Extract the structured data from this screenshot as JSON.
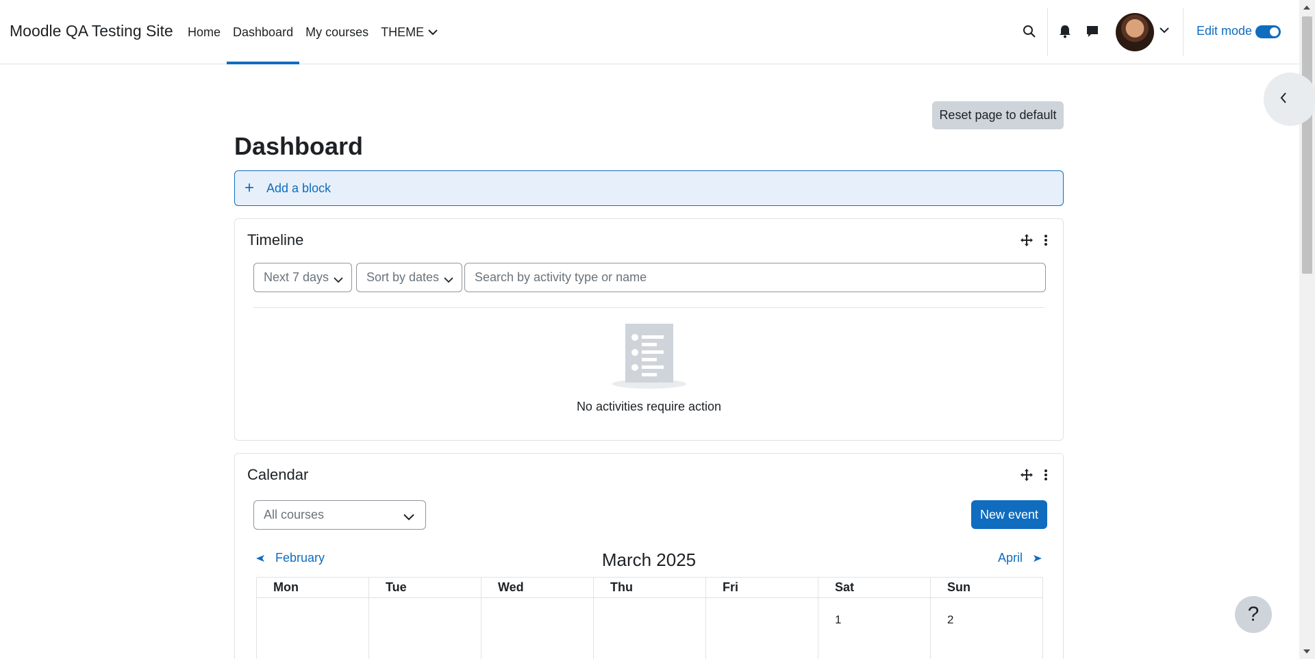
{
  "site": {
    "name": "Moodle QA Testing Site"
  },
  "nav": {
    "items": [
      {
        "label": "Home",
        "active": false
      },
      {
        "label": "Dashboard",
        "active": true
      },
      {
        "label": "My courses",
        "active": false
      },
      {
        "label": "THEME",
        "active": false,
        "dropdown": true
      }
    ]
  },
  "header": {
    "icons": [
      "search-icon",
      "bell-icon",
      "message-icon"
    ],
    "edit_mode_label": "Edit mode",
    "edit_mode_on": true
  },
  "page": {
    "reset_label": "Reset page to default",
    "title": "Dashboard",
    "add_block_label": "Add a block"
  },
  "timeline": {
    "title": "Timeline",
    "filter_days": "Next 7 days",
    "sort": "Sort by dates",
    "search_placeholder": "Search by activity type or name",
    "empty_text": "No activities require action"
  },
  "calendar": {
    "title": "Calendar",
    "course_filter": "All courses",
    "new_event_label": "New event",
    "prev_month": "February",
    "current_month": "March 2025",
    "next_month": "April",
    "weekdays": [
      "Mon",
      "Tue",
      "Wed",
      "Thu",
      "Fri",
      "Sat",
      "Sun"
    ],
    "first_row": [
      "",
      "",
      "",
      "",
      "",
      "1",
      "2"
    ]
  },
  "help": {
    "label": "?"
  },
  "colors": {
    "primary": "#0f6cbf",
    "secondary": "#ced4da",
    "border": "#dee2e6",
    "text": "#1d2125"
  }
}
